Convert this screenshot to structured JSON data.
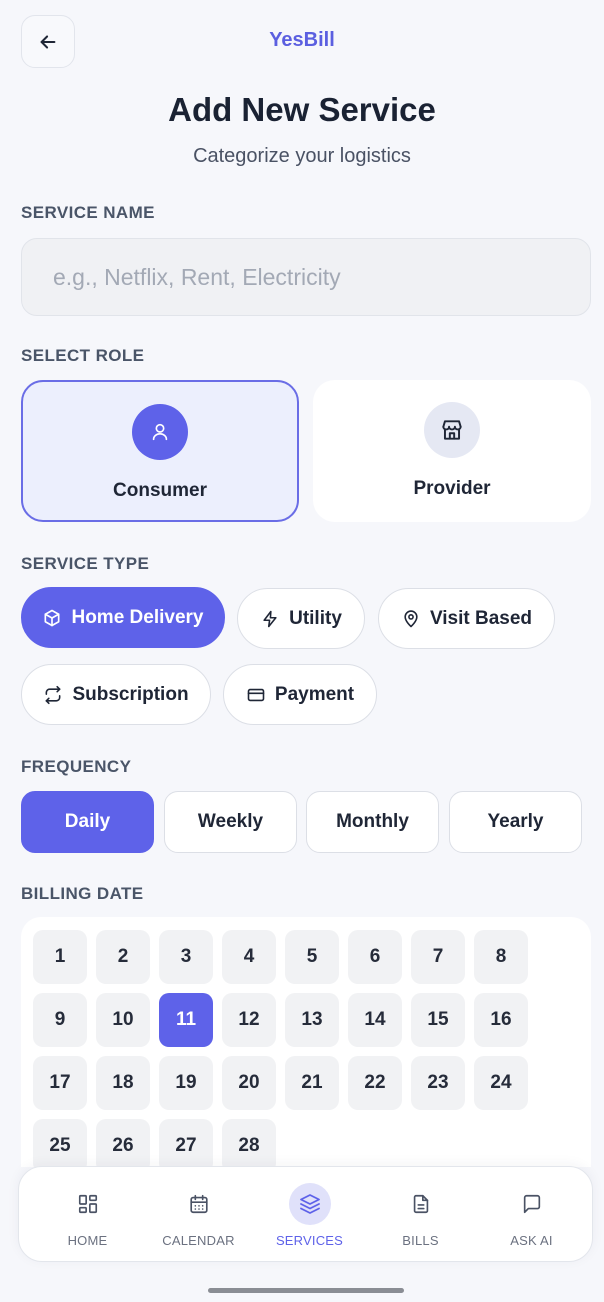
{
  "header": {
    "app_name": "YesBill",
    "title": "Add New Service",
    "subtitle": "Categorize your logistics"
  },
  "service_name": {
    "label": "SERVICE NAME",
    "placeholder": "e.g., Netflix, Rent, Electricity",
    "value": ""
  },
  "role": {
    "label": "SELECT ROLE",
    "selected": "Consumer",
    "options": [
      {
        "label": "Consumer",
        "icon": "user-icon"
      },
      {
        "label": "Provider",
        "icon": "store-icon"
      }
    ]
  },
  "service_type": {
    "label": "SERVICE TYPE",
    "selected": "Home Delivery",
    "options": [
      {
        "label": "Home Delivery",
        "icon": "box-icon"
      },
      {
        "label": "Utility",
        "icon": "lightning-icon"
      },
      {
        "label": "Visit Based",
        "icon": "map-pin-icon"
      },
      {
        "label": "Subscription",
        "icon": "repeat-icon"
      },
      {
        "label": "Payment",
        "icon": "credit-card-icon"
      }
    ]
  },
  "frequency": {
    "label": "FREQUENCY",
    "selected": "Daily",
    "options": [
      "Daily",
      "Weekly",
      "Monthly",
      "Yearly"
    ]
  },
  "billing_date": {
    "label": "BILLING DATE",
    "selected": "11",
    "days": [
      "1",
      "2",
      "3",
      "4",
      "5",
      "6",
      "7",
      "8",
      "9",
      "10",
      "11",
      "12",
      "13",
      "14",
      "15",
      "16",
      "17",
      "18",
      "19",
      "20",
      "21",
      "22",
      "23",
      "24",
      "25",
      "26",
      "27",
      "28"
    ]
  },
  "nav": {
    "active": "SERVICES",
    "items": [
      {
        "label": "HOME",
        "icon": "grid-icon"
      },
      {
        "label": "CALENDAR",
        "icon": "calendar-icon"
      },
      {
        "label": "SERVICES",
        "icon": "layers-icon"
      },
      {
        "label": "BILLS",
        "icon": "document-icon"
      },
      {
        "label": "ASK AI",
        "icon": "chat-icon"
      }
    ]
  },
  "colors": {
    "accent": "#5e62e9",
    "brand": "#5b5fe0",
    "background": "#f6f7fb"
  }
}
